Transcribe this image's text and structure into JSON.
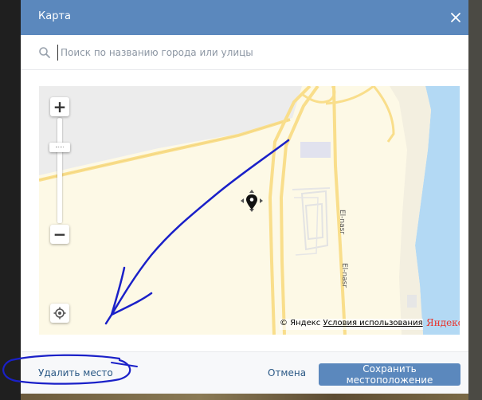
{
  "modal": {
    "title": "Карта",
    "close_icon": "close-icon"
  },
  "search": {
    "value": "",
    "placeholder": "Поиск по названию города или улицы",
    "icon": "search-icon"
  },
  "map": {
    "street_labels": [
      "El-nasr",
      "El-nasr"
    ],
    "copyright": {
      "prefix": "© Яндекс",
      "terms_label": "Условия использования"
    },
    "logo": "Яндекс",
    "controls": {
      "zoom_in": "+",
      "zoom_out": "−",
      "zoom_level": 0.75,
      "geolocation_icon": "geolocation-icon"
    },
    "colors": {
      "land": "#fdf9e6",
      "water": "#b3d9f4",
      "road": "#f9de8b",
      "urban": "#ececec"
    }
  },
  "footer": {
    "delete_label": "Удалить место",
    "cancel_label": "Отмена",
    "save_label": "Сохранить местоположение"
  },
  "accent_color": "#5b88bd"
}
